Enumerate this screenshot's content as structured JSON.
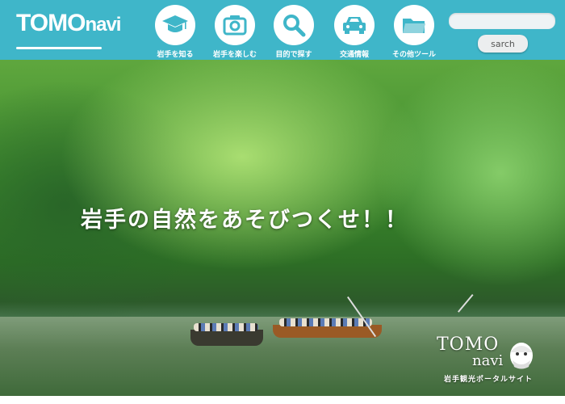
{
  "header": {
    "logo_main": "TOMO",
    "logo_sub": "navi",
    "nav": [
      {
        "label": "岩手を知る",
        "icon": "graduation-cap-icon"
      },
      {
        "label": "岩手を楽しむ",
        "icon": "camera-icon"
      },
      {
        "label": "目的で探す",
        "icon": "search-icon"
      },
      {
        "label": "交通情報",
        "icon": "car-icon"
      },
      {
        "label": "その他ツール",
        "icon": "folder-icon"
      }
    ],
    "search": {
      "placeholder": "",
      "value": "",
      "button_label": "sarch"
    }
  },
  "hero": {
    "headline": "岩手の自然をあそびつくせ！！",
    "watermark_title": "TOMO",
    "watermark_subtitle": "navi",
    "watermark_tagline": "岩手観光ポータルサイト"
  },
  "colors": {
    "header_bg": "#3fb6c9",
    "accent": "#ffffff"
  }
}
